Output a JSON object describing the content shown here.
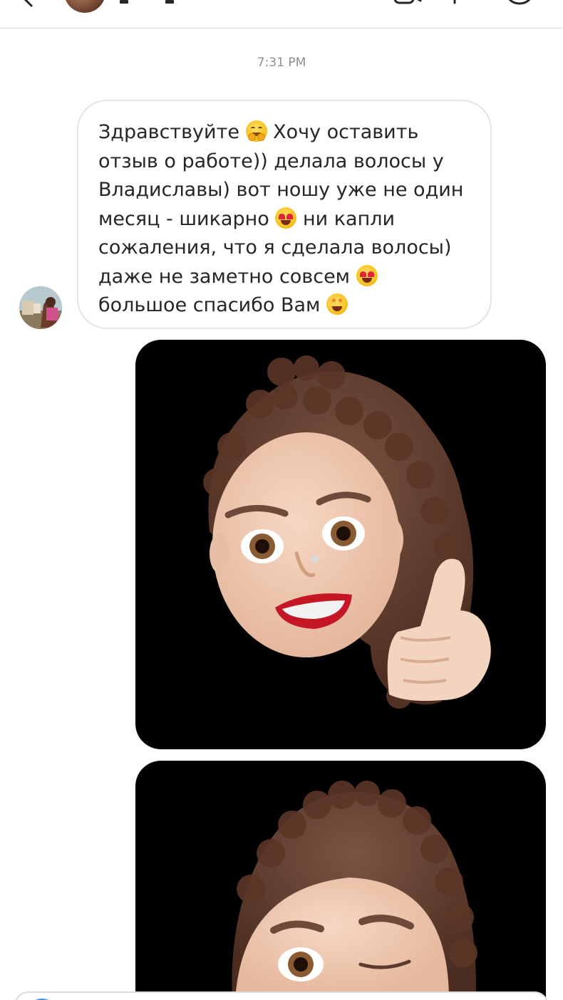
{
  "header": {
    "back_icon": "chevron-left-icon",
    "video_icon": "video-camera-icon",
    "info_icon": "info-icon",
    "call_icon": "phone-icon"
  },
  "conversation": {
    "timestamp": "7:31 PM",
    "message": {
      "lines": [
        {
          "text_before": "Здравствуйте ",
          "emoji": "hugging-face-emoji",
          "text_after": " Хочу оставить"
        },
        {
          "text_before": "отзыв о работе)) делала волосы у",
          "emoji": null,
          "text_after": ""
        },
        {
          "text_before": "Владиславы) вот ношу уже не один",
          "emoji": null,
          "text_after": ""
        },
        {
          "text_before": "месяц - шикарно ",
          "emoji": "heart-eyes-emoji",
          "text_after": " ни капли"
        },
        {
          "text_before": "сожаления, что я сделала волосы)",
          "emoji": null,
          "text_after": ""
        },
        {
          "text_before": "даже не заметно совсем ",
          "emoji": "heart-eyes-emoji",
          "text_after": ""
        },
        {
          "text_before": "большое спасибо Вам ",
          "emoji": "star-struck-emoji",
          "text_after": ""
        }
      ]
    },
    "attachments": [
      {
        "kind": "memoji-sticker",
        "depicts": "memoji thumbs up"
      },
      {
        "kind": "memoji-sticker",
        "depicts": "memoji winking"
      }
    ]
  },
  "composer": {
    "camera_icon": "camera-icon"
  },
  "colors": {
    "bubble_border": "#e4e4e4",
    "text": "#262626",
    "timestamp": "#8e8e8e",
    "photo_background": "#000000",
    "accent": "#3797f0"
  }
}
